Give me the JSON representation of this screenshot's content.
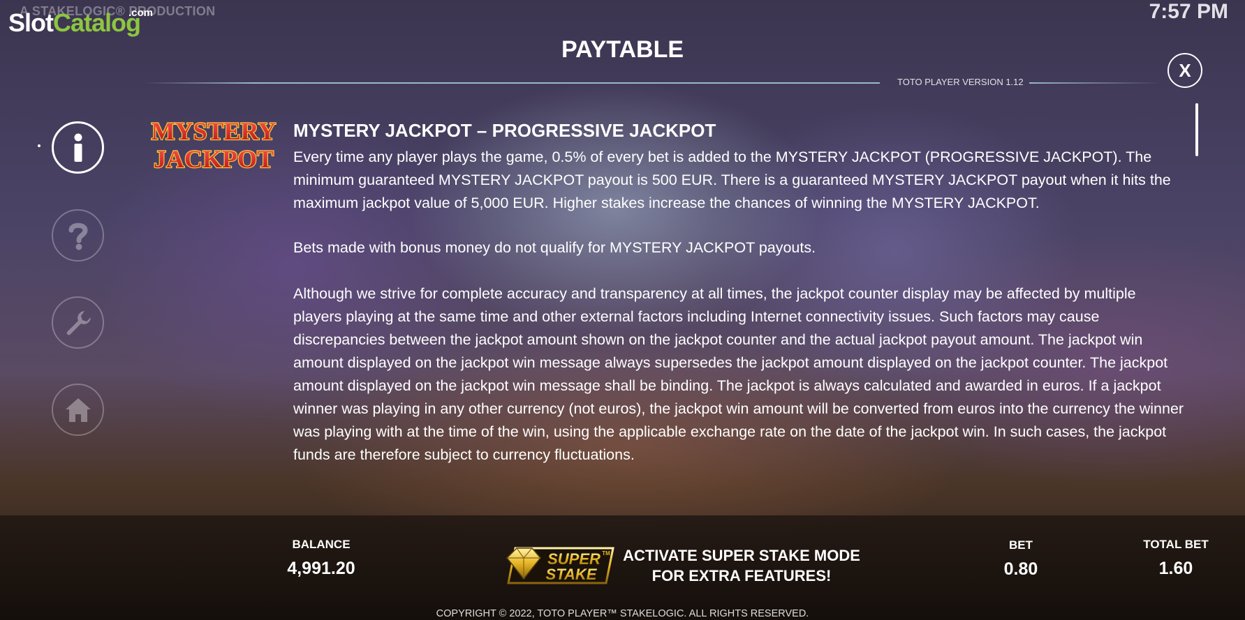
{
  "top": {
    "production_text": "A STAKELOGIC® PRODUCTION",
    "watermark_slot": "Slot",
    "watermark_catalog": "Catalog",
    "watermark_com": ".com",
    "clock": "7:57 PM"
  },
  "header": {
    "title": "PAYTABLE",
    "version": "TOTO PLAYER VERSION 1.12",
    "close_label": "X"
  },
  "side_menu": {
    "items": [
      {
        "name": "info",
        "icon": "info-icon",
        "active": true
      },
      {
        "name": "help",
        "icon": "question-icon",
        "active": false
      },
      {
        "name": "settings",
        "icon": "wrench-icon",
        "active": false
      },
      {
        "name": "home",
        "icon": "home-icon",
        "active": false
      }
    ]
  },
  "content": {
    "logo_line1": "MYSTERY",
    "logo_line2": "JACKPOT",
    "section_title": "MYSTERY JACKPOT – PROGRESSIVE JACKPOT",
    "paragraph1": "Every time any player plays the game, 0.5% of every bet is added to the MYSTERY JACKPOT (PROGRESSIVE JACKPOT). The minimum guaranteed MYSTERY JACKPOT payout is 500 EUR. There is a guaranteed MYSTERY JACKPOT payout when it hits the maximum jackpot value of 5,000 EUR. Higher stakes increase the chances of winning the MYSTERY JACKPOT.",
    "paragraph2": "Bets made with bonus money do not qualify for MYSTERY JACKPOT payouts.",
    "paragraph3": "Although we strive for complete accuracy and transparency at all times, the jackpot counter display may be affected by multiple players playing at the same time and other external factors including Internet connectivity issues. Such factors may cause discrepancies between the jackpot amount shown on the jackpot counter and the actual jackpot payout amount. The jackpot win amount displayed on the jackpot win message always supersedes the jackpot amount displayed on the jackpot counter. The jackpot amount displayed on the jackpot win message shall be binding. The jackpot is always calculated and awarded in euros. If a jackpot winner was playing in any other currency (not euros), the jackpot win amount will be converted from euros into the currency the winner was playing with at the time of the win, using the applicable exchange rate on the date of the jackpot win. In such cases, the jackpot funds are therefore subject to currency fluctuations."
  },
  "bottom_bar": {
    "balance_label": "BALANCE",
    "balance_value": "4,991.20",
    "super_stake_line1": "SUPER",
    "super_stake_line2": "STAKE",
    "super_stake_tm": "TM",
    "promo_line1": "ACTIVATE SUPER STAKE MODE",
    "promo_line2": "FOR EXTRA FEATURES!",
    "bet_label": "BET",
    "bet_value": "0.80",
    "total_bet_label": "TOTAL BET",
    "total_bet_value": "1.60",
    "copyright": "COPYRIGHT © 2022, TOTO PLAYER™ STAKELOGIC. ALL RIGHTS RESERVED."
  },
  "colors": {
    "watermark_green": "#8cc63f",
    "jackpot_red": "#e8202a",
    "jackpot_yellow": "#ffd23a",
    "gold": "#e6b422"
  }
}
